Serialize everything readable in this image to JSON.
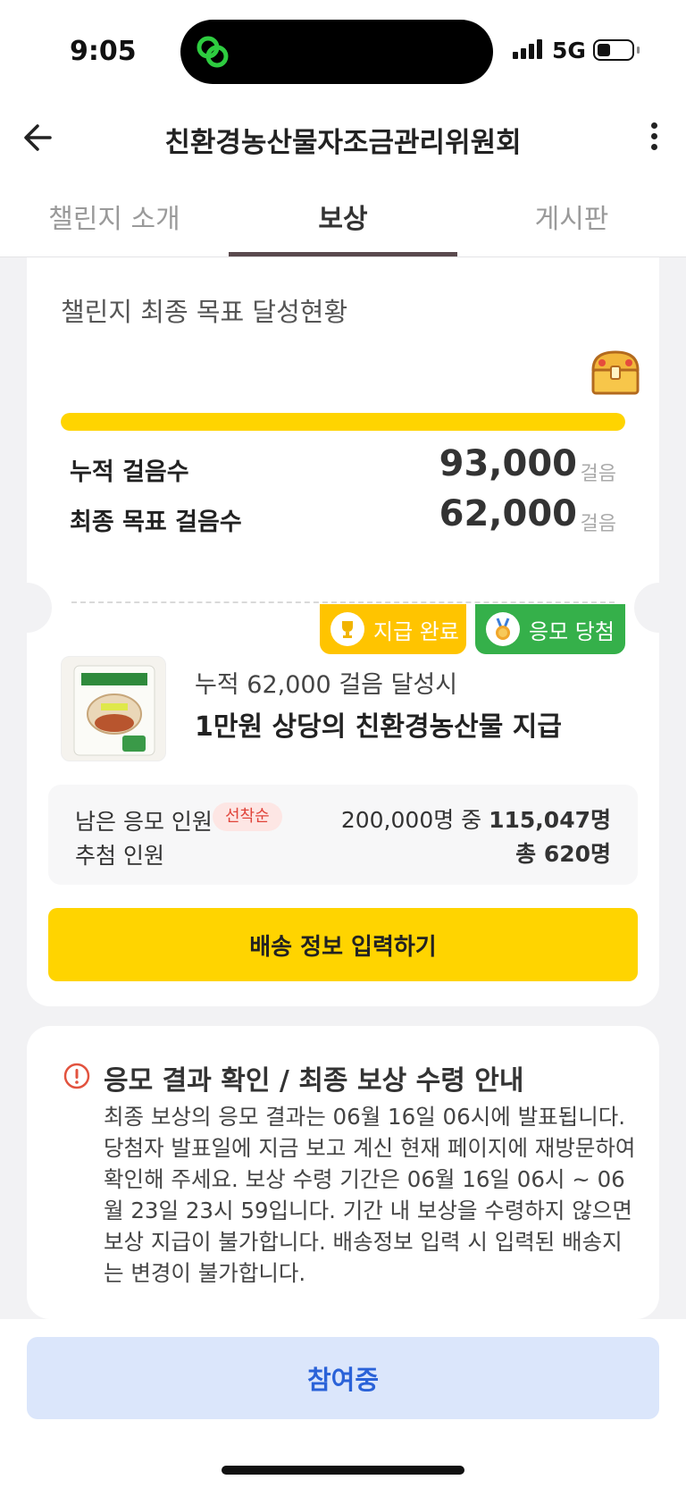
{
  "status_bar": {
    "time": "9:05",
    "network": "5G"
  },
  "header": {
    "title": "친환경농산물자조금관리위원회"
  },
  "tabs": [
    {
      "label": "챌린지 소개",
      "active": false
    },
    {
      "label": "보상",
      "active": true
    },
    {
      "label": "게시판",
      "active": false
    }
  ],
  "goal_card": {
    "title": "챌린지 최종 목표 달성현황",
    "progress_fraction": 1.0,
    "accumulated_label": "누적 걸음수",
    "accumulated_value": "93,000",
    "target_label": "최종 목표 걸음수",
    "target_value": "62,000",
    "unit": "걸음",
    "badges": {
      "paid": "지급 완료",
      "won": "응모 당첨"
    },
    "reward": {
      "condition": "누적 62,000 걸음 달성시",
      "name": "1만원 상당의 친환경농산물 지급"
    },
    "info": {
      "remaining_label": "남은 응모 인원",
      "tag": "선착순",
      "remaining_total": "200,000명 중 ",
      "remaining_count": "115,047명",
      "draw_label": "추첨 인원",
      "draw_value": "총 620명"
    },
    "button_label": "배송 정보 입력하기"
  },
  "notice": {
    "title": "응모 결과 확인 / 최종 보상 수령 안내",
    "body": "최종 보상의 응모 결과는 06월 16일 06시에 발표됩니다. 당첨자 발표일에 지금 보고 계신 현재 페이지에 재방문하여 확인해 주세요. 보상 수령 기간은 06월 16일 06시 ~ 06월 23일 23시 59입니다. 기간 내 보상을 수령하지 않으면 보상 지급이 불가합니다. 배송정보 입력 시 입력된 배송지는 변경이 불가합니다."
  },
  "bottom": {
    "button_label": "참여중"
  },
  "colors": {
    "accent_yellow": "#ffd400",
    "success_green": "#35b04a",
    "link_blue": "#2a62d8"
  }
}
